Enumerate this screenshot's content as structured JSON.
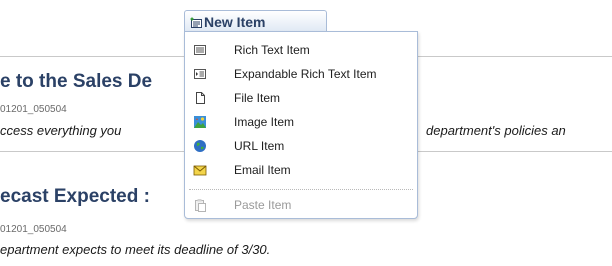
{
  "background": {
    "articles": [
      {
        "headline": "e to the Sales De",
        "meta": "01201_050504",
        "snippet_left": "ccess everything you",
        "snippet_right": "department's policies an"
      },
      {
        "headline": "ecast Expected :",
        "meta": "01201_050504",
        "snippet_left": "epartment expects to meet its deadline of 3/30."
      }
    ]
  },
  "toolbar": {
    "new_item_label": "New Item",
    "new_item_icon": "new-item-icon"
  },
  "menu": {
    "items": [
      {
        "label": "Rich Text Item",
        "icon": "rich-text-icon",
        "enabled": true
      },
      {
        "label": "Expandable Rich Text Item",
        "icon": "expandable-rich-text-icon",
        "enabled": true
      },
      {
        "label": "File Item",
        "icon": "file-icon",
        "enabled": true
      },
      {
        "label": "Image Item",
        "icon": "image-icon",
        "enabled": true
      },
      {
        "label": "URL Item",
        "icon": "globe-icon",
        "enabled": true
      },
      {
        "label": "Email Item",
        "icon": "envelope-icon",
        "enabled": true
      },
      {
        "label": "Paste Item",
        "icon": "paste-icon",
        "enabled": false
      }
    ]
  },
  "colors": {
    "headline": "#2b4166",
    "menu_border": "#a9bcd8",
    "disabled_text": "#9a9a9a"
  }
}
